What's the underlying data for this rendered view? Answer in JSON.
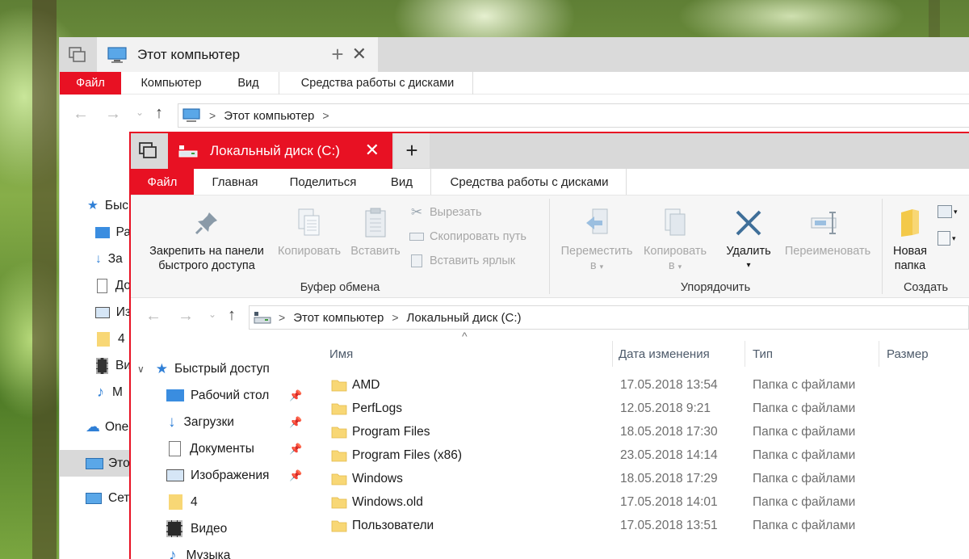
{
  "back_window": {
    "tab_title": "Этот компьютер",
    "ribbon_tabs": [
      "Файл",
      "Компьютер",
      "Вид",
      "Средства работы с дисками"
    ],
    "address": [
      "Этот компьютер"
    ],
    "nav_items": [
      "Быс",
      "Ра",
      "За",
      "До",
      "Из",
      "4",
      "Ви",
      "М",
      "One",
      "Это",
      "Сет"
    ]
  },
  "front_window": {
    "tab_title": "Локальный диск (C:)",
    "ribbon_tabs": [
      "Файл",
      "Главная",
      "Поделиться",
      "Вид",
      "Средства работы с дисками"
    ],
    "clipboard": {
      "label": "Буфер обмена",
      "pin_label_1": "Закрепить на панели",
      "pin_label_2": "быстрого доступа",
      "copy": "Копировать",
      "paste": "Вставить",
      "cut": "Вырезать",
      "copy_path": "Скопировать путь",
      "paste_shortcut": "Вставить ярлык"
    },
    "organize": {
      "label": "Упорядочить",
      "move_1": "Переместить",
      "move_2": "в",
      "copy_1": "Копировать",
      "copy_2": "в",
      "delete": "Удалить",
      "rename": "Переименовать"
    },
    "create": {
      "label": "Создать",
      "new_folder_1": "Новая",
      "new_folder_2": "папка"
    },
    "address": [
      "Этот компьютер",
      "Локальный диск (C:)"
    ],
    "nav": [
      {
        "label": "Быстрый доступ",
        "icon": "star-icon"
      },
      {
        "label": "Рабочий стол",
        "icon": "desktop-icon",
        "pinned": true
      },
      {
        "label": "Загрузки",
        "icon": "download-icon",
        "pinned": true
      },
      {
        "label": "Документы",
        "icon": "document-icon",
        "pinned": true
      },
      {
        "label": "Изображения",
        "icon": "image-icon",
        "pinned": true
      },
      {
        "label": "4",
        "icon": "folder-icon"
      },
      {
        "label": "Видео",
        "icon": "video-icon"
      },
      {
        "label": "Музыка",
        "icon": "music-icon"
      }
    ],
    "columns": [
      "Имя",
      "Дата изменения",
      "Тип",
      "Размер"
    ],
    "files": [
      {
        "name": "AMD",
        "date": "17.05.2018 13:54",
        "type": "Папка с файлами"
      },
      {
        "name": "PerfLogs",
        "date": "12.05.2018 9:21",
        "type": "Папка с файлами"
      },
      {
        "name": "Program Files",
        "date": "18.05.2018 17:30",
        "type": "Папка с файлами"
      },
      {
        "name": "Program Files (x86)",
        "date": "23.05.2018 14:14",
        "type": "Папка с файлами"
      },
      {
        "name": "Windows",
        "date": "18.05.2018 17:29",
        "type": "Папка с файлами"
      },
      {
        "name": "Windows.old",
        "date": "17.05.2018 14:01",
        "type": "Папка с файлами"
      },
      {
        "name": "Пользователи",
        "date": "17.05.2018 13:51",
        "type": "Папка с файлами"
      }
    ]
  },
  "colors": {
    "accent": "#e81123",
    "folder": "#f8d775"
  }
}
